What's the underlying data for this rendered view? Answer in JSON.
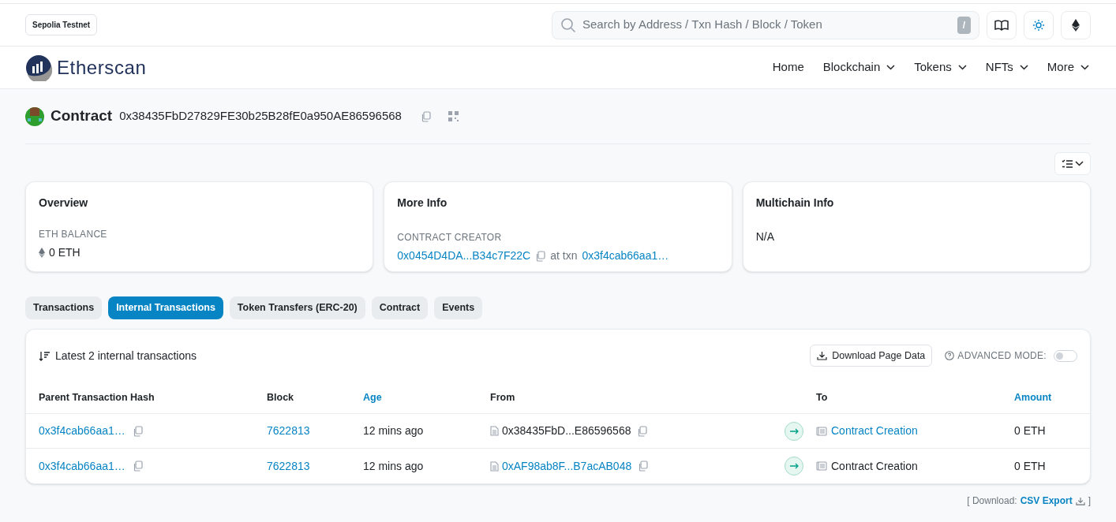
{
  "network_badge": "Sepolia Testnet",
  "search": {
    "placeholder": "Search by Address / Txn Hash / Block / Token",
    "shortcut": "/"
  },
  "logo": {
    "text": "Etherscan"
  },
  "nav": [
    {
      "label": "Home",
      "dropdown": false
    },
    {
      "label": "Blockchain",
      "dropdown": true
    },
    {
      "label": "Tokens",
      "dropdown": true
    },
    {
      "label": "NFTs",
      "dropdown": true
    },
    {
      "label": "More",
      "dropdown": true
    }
  ],
  "page_title": {
    "label": "Contract",
    "address": "0x38435FbD27829FE30b25B28fE0a950AE86596568"
  },
  "cards": [
    {
      "title": "Overview",
      "kind": "balance",
      "label": "ETH BALANCE",
      "value": "0 ETH"
    },
    {
      "title": "More Info",
      "kind": "creator",
      "label": "CONTRACT CREATOR",
      "creator": "0x0454D4DA...B34c7F22C",
      "at_text": "at txn",
      "txn": "0x3f4cab66aa1…"
    },
    {
      "title": "Multichain Info",
      "kind": "plain",
      "value": "N/A"
    }
  ],
  "tabs": [
    {
      "label": "Transactions",
      "selected": false
    },
    {
      "label": "Internal Transactions",
      "selected": true
    },
    {
      "label": "Token Transfers (ERC-20)",
      "selected": false
    },
    {
      "label": "Contract",
      "selected": false
    },
    {
      "label": "Events",
      "selected": false
    }
  ],
  "table": {
    "summary": "Latest 2 internal transactions",
    "download_button": "Download Page Data",
    "advanced_mode": {
      "label": "ADVANCED MODE:",
      "on": false
    },
    "columns": [
      {
        "label": "Parent Transaction Hash",
        "link": false
      },
      {
        "label": "Block",
        "link": false
      },
      {
        "label": "Age",
        "link": true
      },
      {
        "label": "From",
        "link": false
      },
      {
        "label": "To",
        "link": false
      },
      {
        "label": "Amount",
        "link": true
      }
    ],
    "rows": [
      {
        "hash": "0x3f4cab66aa1…",
        "block": "7622813",
        "age": "12 mins ago",
        "from": "0x38435FbD...E86596568",
        "from_link": false,
        "to": "Contract Creation",
        "to_link": true,
        "amount": "0 ETH"
      },
      {
        "hash": "0x3f4cab66aa1…",
        "block": "7622813",
        "age": "12 mins ago",
        "from": "0xAF98ab8F...B7acAB048",
        "from_link": true,
        "to": "Contract Creation",
        "to_link": false,
        "amount": "0 ETH"
      }
    ]
  },
  "footer": {
    "prefix": "[ Download:",
    "link": "CSV Export",
    "suffix": "]"
  }
}
